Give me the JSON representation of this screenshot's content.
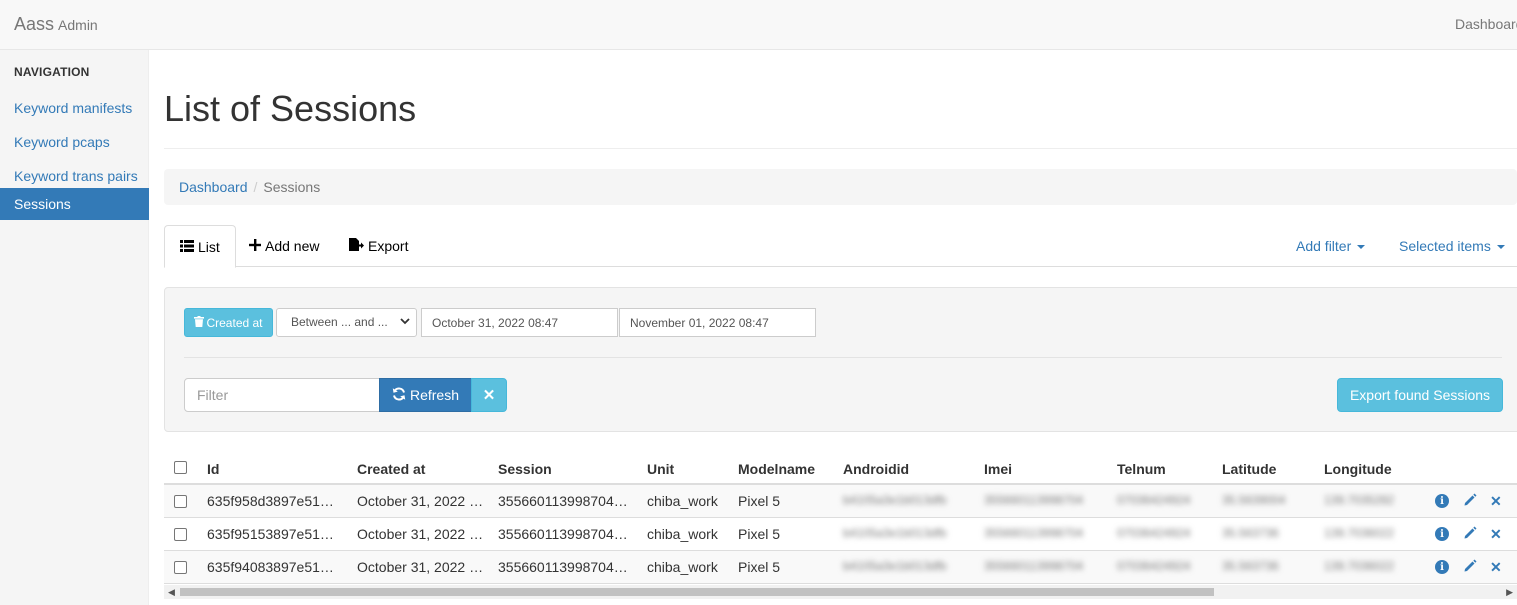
{
  "navbar": {
    "brand": "Aass",
    "brand_small": "Admin",
    "right_link": "Dashboard"
  },
  "sidebar": {
    "header": "NAVIGATION",
    "items": [
      {
        "label": "Keyword manifests",
        "active": false
      },
      {
        "label": "Keyword pcaps",
        "active": false
      },
      {
        "label": "Keyword trans pairs",
        "active": false
      },
      {
        "label": "Sessions",
        "active": true
      }
    ]
  },
  "page": {
    "title": "List of Sessions"
  },
  "breadcrumb": {
    "home": "Dashboard",
    "current": "Sessions"
  },
  "tabs": {
    "list": "List",
    "add_new": "Add new",
    "export": "Export",
    "add_filter": "Add filter",
    "selected_items": "Selected items"
  },
  "filter": {
    "field_label": "Created at",
    "operator": "Between ... and ...",
    "from_value": "October 31, 2022 08:47",
    "to_value": "November 01, 2022 08:47",
    "search_placeholder": "Filter",
    "refresh_label": "Refresh",
    "export_found_label": "Export found Sessions"
  },
  "table": {
    "columns": [
      "Id",
      "Created at",
      "Session",
      "Unit",
      "Modelname",
      "Androidid",
      "Imei",
      "Telnum",
      "Latitude",
      "Longitude"
    ],
    "rows": [
      {
        "id": "635f958d3897e51…",
        "created_at": "October 31, 2022 …",
        "session": "355660113998704…",
        "unit": "chiba_work",
        "modelname": "Pixel 5",
        "androidid": "b4105a3e1b013dfb",
        "imei": "355660113998704",
        "telnum": "07036424924",
        "latitude": "35.5639004",
        "longitude": "139.7035282"
      },
      {
        "id": "635f95153897e51…",
        "created_at": "October 31, 2022 …",
        "session": "355660113998704…",
        "unit": "chiba_work",
        "modelname": "Pixel 5",
        "androidid": "b4105a3e1b013dfb",
        "imei": "355660113998704",
        "telnum": "07036424924",
        "latitude": "35.563736",
        "longitude": "139.7036022"
      },
      {
        "id": "635f94083897e51…",
        "created_at": "October 31, 2022 …",
        "session": "355660113998704…",
        "unit": "chiba_work",
        "modelname": "Pixel 5",
        "androidid": "b4105a3e1b013dfb",
        "imei": "355660113998704",
        "telnum": "07036424924",
        "latitude": "35.563736",
        "longitude": "139.7036022"
      }
    ]
  },
  "colors": {
    "primary": "#337ab7",
    "info": "#5bc0de",
    "navbar": "#f8f8f8"
  },
  "icons": {
    "list": "list-icon",
    "add": "plus-icon",
    "export": "export-file-icon",
    "trash": "trash-icon",
    "refresh": "refresh-icon",
    "clear": "close-icon",
    "row_info": "info-circle-icon",
    "row_edit": "pencil-icon",
    "row_delete": "close-icon"
  }
}
